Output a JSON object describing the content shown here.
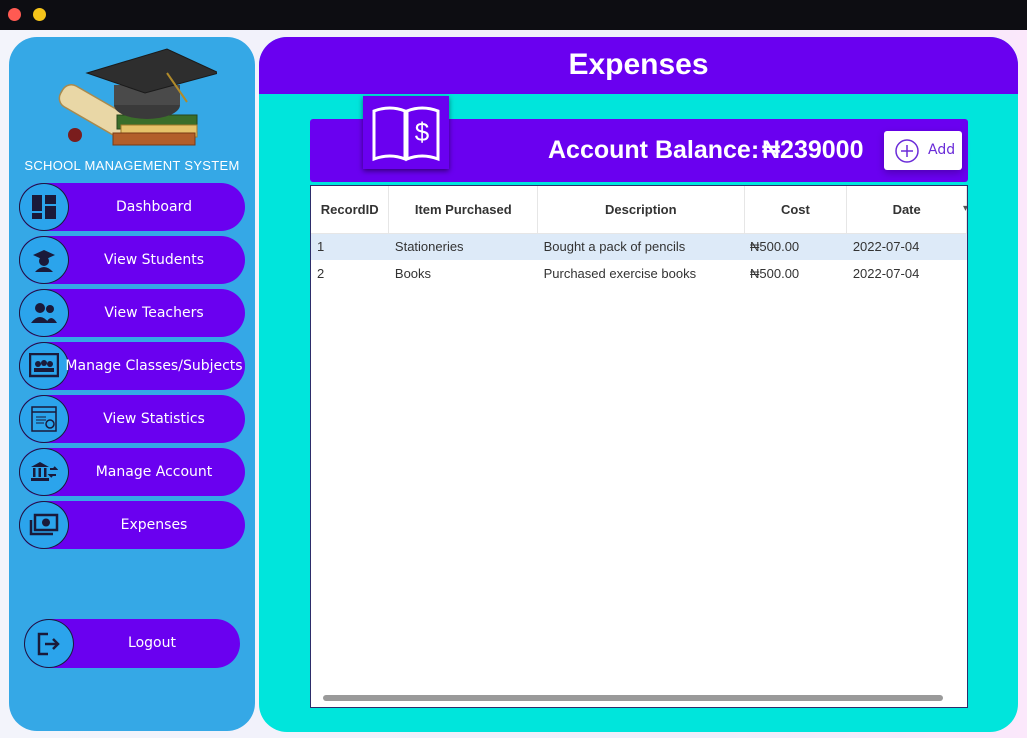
{
  "window": {
    "controls": [
      "close",
      "minimize"
    ]
  },
  "sidebar": {
    "brand": "SCHOOL MANAGEMENT SYSTEM",
    "items": [
      {
        "label": "Dashboard",
        "icon": "dashboard-icon"
      },
      {
        "label": "View Students",
        "icon": "graduate-icon"
      },
      {
        "label": "View Teachers",
        "icon": "users-icon"
      },
      {
        "label": "Manage Classes/Subjects",
        "icon": "classroom-icon"
      },
      {
        "label": "View Statistics",
        "icon": "statistics-icon"
      },
      {
        "label": "Manage Account",
        "icon": "bank-transfer-icon"
      },
      {
        "label": "Expenses",
        "icon": "money-icon"
      }
    ],
    "logout": {
      "label": "Logout",
      "icon": "logout-icon"
    }
  },
  "main": {
    "title": "Expenses",
    "balance_label": "Account Balance:",
    "balance_value": "₦239000",
    "add_label": "Add",
    "table": {
      "columns": [
        "RecordID",
        "Item Purchased",
        "Description",
        "Cost",
        "Date"
      ],
      "rows": [
        [
          "1",
          "Stationeries",
          "Bought a pack of pencils",
          "₦500.00",
          "2022-07-04"
        ],
        [
          "2",
          "Books",
          "Purchased exercise books",
          "₦500.00",
          "2022-07-04"
        ]
      ]
    }
  },
  "colors": {
    "sidebar": "#35a8e6",
    "accent_purple": "#6a00f0",
    "main_bg": "#00e5dc",
    "selected_row": "#ddeaf8"
  }
}
